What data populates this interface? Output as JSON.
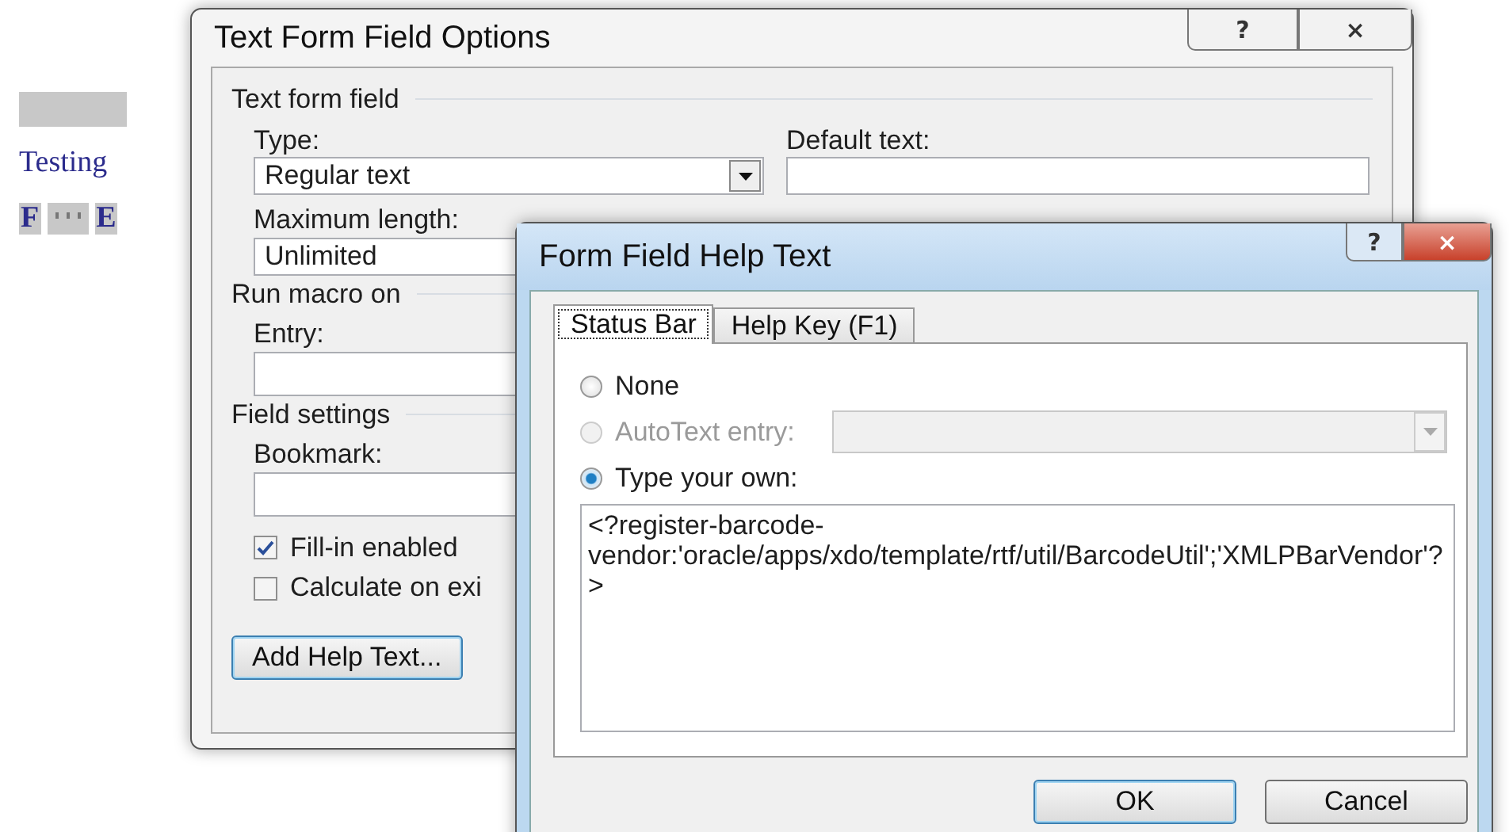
{
  "document": {
    "word": "Testing",
    "field_start": "F",
    "field_end": "E"
  },
  "options_dialog": {
    "title": "Text Form Field Options",
    "help_button": "?",
    "close_button": "×",
    "text_form_field": {
      "heading": "Text form field",
      "type_label": "Type:",
      "type_value": "Regular text",
      "max_label": "Maximum length:",
      "max_value": "Unlimited",
      "default_label": "Default text:"
    },
    "run_macro": {
      "heading": "Run macro on",
      "entry_label": "Entry:"
    },
    "field_settings": {
      "heading": "Field settings",
      "bookmark_label": "Bookmark:",
      "checkboxes": [
        {
          "label": "Fill-in enabled",
          "checked": true
        },
        {
          "label": "Calculate on exi",
          "checked": false
        }
      ]
    },
    "add_help_button": "Add Help Text..."
  },
  "help_dialog": {
    "title": "Form Field Help Text",
    "help_button": "?",
    "close_button": "×",
    "tabs": [
      {
        "label": "Status Bar",
        "selected": true
      },
      {
        "label": "Help Key (F1)",
        "selected": false
      }
    ],
    "options": [
      {
        "label": "None",
        "selected": false,
        "disabled": false,
        "kind": "plain"
      },
      {
        "label": "AutoText entry:",
        "selected": false,
        "disabled": true,
        "kind": "combo"
      },
      {
        "label": "Type your own:",
        "selected": true,
        "disabled": false,
        "kind": "plain"
      }
    ],
    "text": "<?register-barcode-vendor:'oracle/apps/xdo/template/rtf/util/BarcodeUtil';'XMLPBarVendor'?>",
    "buttons": [
      "OK",
      "Cancel"
    ]
  }
}
